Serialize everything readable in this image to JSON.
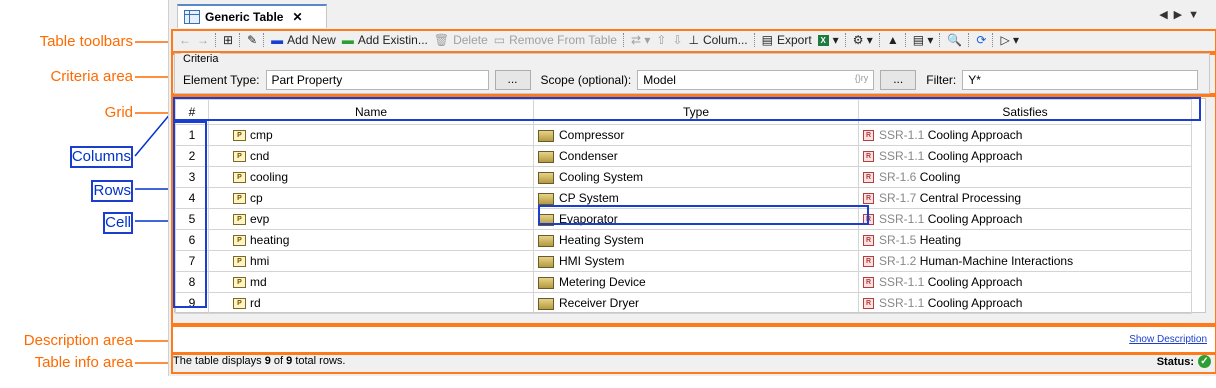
{
  "annotations": {
    "toolbars": "Table toolbars",
    "criteria": "Criteria area",
    "grid": "Grid",
    "columns": "Columns",
    "rows": "Rows",
    "cell": "Cell",
    "description": "Description area",
    "info": "Table info area"
  },
  "tab": {
    "title": "Generic Table",
    "close": "✕"
  },
  "toolbar": {
    "add_new": "Add New",
    "add_existing": "Add Existin...",
    "delete": "Delete",
    "remove": "Remove From Table",
    "columns": "Colum...",
    "export": "Export"
  },
  "criteria": {
    "title": "Criteria",
    "element_type_label": "Element Type:",
    "element_type_value": "Part Property",
    "browse": "...",
    "scope_label": "Scope (optional):",
    "scope_value": "Model",
    "scope_hint": "{}ry",
    "filter_label": "Filter:",
    "filter_icon": "Y*"
  },
  "grid": {
    "headers": [
      "#",
      "Name",
      "Type",
      "Satisfies"
    ],
    "rows": [
      {
        "n": "1",
        "name": "cmp",
        "type": "Compressor",
        "rid": "SSR-1.1",
        "req": "Cooling Approach"
      },
      {
        "n": "2",
        "name": "cnd",
        "type": "Condenser",
        "rid": "SSR-1.1",
        "req": "Cooling Approach"
      },
      {
        "n": "3",
        "name": "cooling",
        "type": "Cooling System",
        "rid": "SR-1.6",
        "req": "Cooling"
      },
      {
        "n": "4",
        "name": "cp",
        "type": "CP System",
        "rid": "SR-1.7",
        "req": "Central Processing"
      },
      {
        "n": "5",
        "name": "evp",
        "type": "Evaporator",
        "rid": "SSR-1.1",
        "req": "Cooling Approach"
      },
      {
        "n": "6",
        "name": "heating",
        "type": "Heating System",
        "rid": "SR-1.5",
        "req": "Heating"
      },
      {
        "n": "7",
        "name": "hmi",
        "type": "HMI System",
        "rid": "SR-1.2",
        "req": "Human-Machine Interactions"
      },
      {
        "n": "8",
        "name": "md",
        "type": "Metering Device",
        "rid": "SSR-1.1",
        "req": "Cooling Approach"
      },
      {
        "n": "9",
        "name": "rd",
        "type": "Receiver Dryer",
        "rid": "SSR-1.1",
        "req": "Cooling Approach"
      }
    ]
  },
  "description": {
    "link": "Show Description"
  },
  "info": {
    "prefix": "The table displays ",
    "shown": "9",
    "mid": " of ",
    "total": "9",
    "suffix": " total rows.",
    "status": "Status:"
  }
}
